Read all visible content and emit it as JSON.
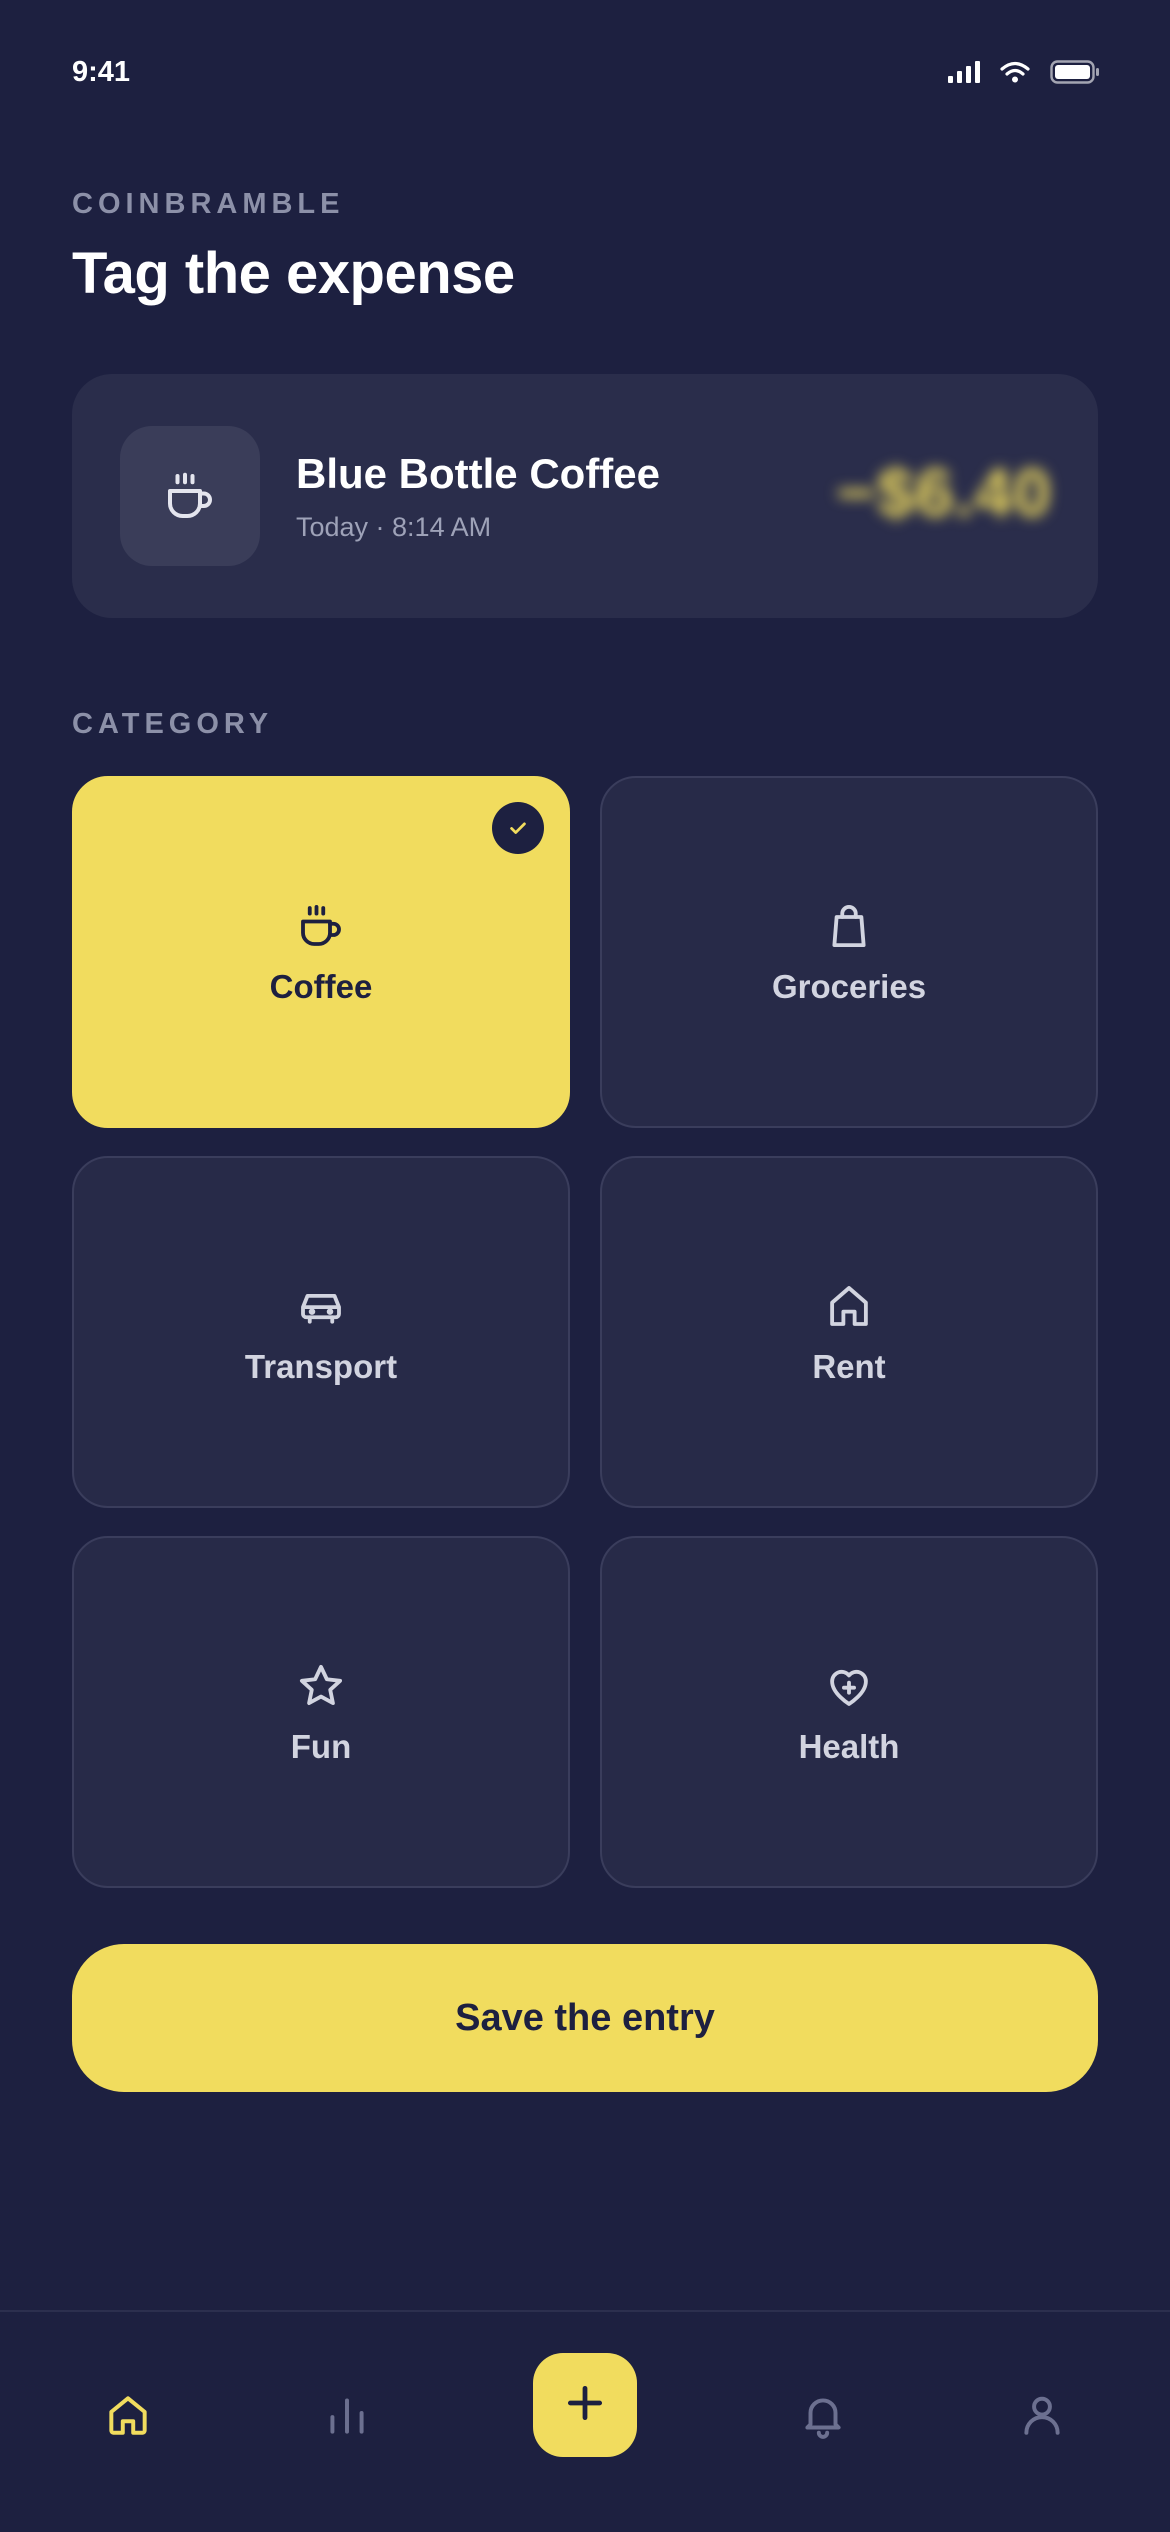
{
  "status_bar": {
    "time": "9:41",
    "icons": [
      "signal-icon",
      "wifi-icon",
      "battery-icon"
    ]
  },
  "header": {
    "brand": "COINBRAMBLE",
    "title": "Tag the expense"
  },
  "transaction": {
    "icon": "coffee-cup-icon",
    "merchant": "Blue Bottle Coffee",
    "time": "Today · 8:14 AM",
    "amount": "−$6.40",
    "amount_obscured": true
  },
  "category_section": {
    "label": "CATEGORY",
    "selected": "Coffee",
    "items": [
      {
        "label": "Coffee",
        "icon": "coffee-cup-icon",
        "selected": true
      },
      {
        "label": "Groceries",
        "icon": "shopping-bag-icon",
        "selected": false
      },
      {
        "label": "Transport",
        "icon": "car-icon",
        "selected": false
      },
      {
        "label": "Rent",
        "icon": "home-icon",
        "selected": false
      },
      {
        "label": "Fun",
        "icon": "star-icon",
        "selected": false
      },
      {
        "label": "Health",
        "icon": "heart-plus-icon",
        "selected": false
      }
    ]
  },
  "actions": {
    "save_label": "Save the entry"
  },
  "tab_bar": {
    "active": "home",
    "tabs": [
      "home-icon",
      "stats-icon",
      "add-icon",
      "bell-icon",
      "profile-icon"
    ]
  },
  "colors": {
    "background": "#1d2040",
    "card": "#2a2d4b",
    "accent": "#f1dc5e",
    "muted_text": "#8c90a8"
  }
}
